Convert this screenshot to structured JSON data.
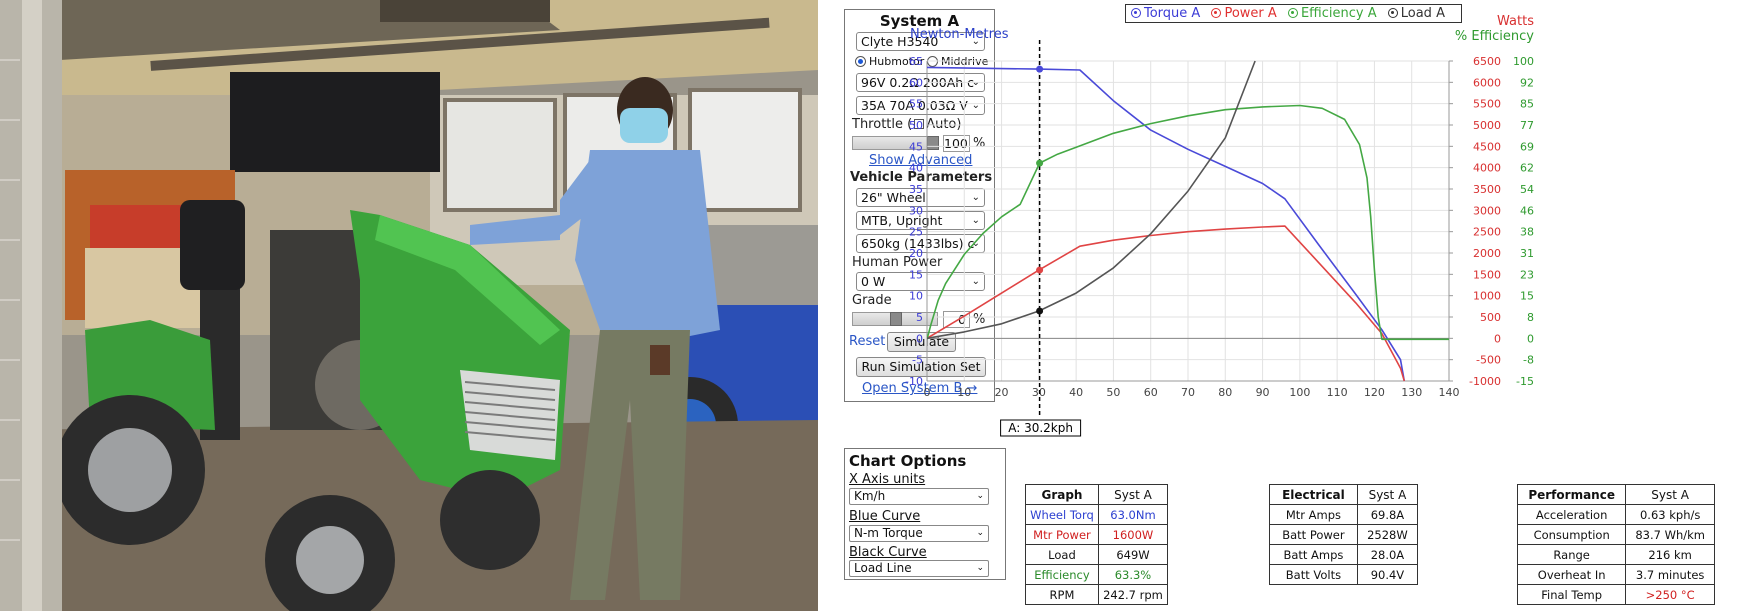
{
  "system_a": {
    "title": "System A",
    "motor": "Clyte H3540",
    "drive_options": [
      "Hubmotor",
      "Middrive"
    ],
    "drive_selected": "Hubmotor",
    "battery": "96V 0.2Ω 200Ah c",
    "controller": "35A 70A 0.03Ω V",
    "throttle_label": "Throttle (",
    "auto_label": "Auto)",
    "throttle_value": "100",
    "throttle_fraction": 1.0,
    "percent_sign": "%",
    "show_advanced": "Show Advanced",
    "vehicle_params_title": "Vehicle Parameters",
    "wheel": "26\"  Wheel",
    "frame": "MTB, Upright",
    "mass": "650kg (1433lbs) c",
    "human_power_label": "Human Power",
    "human_power": "0 W",
    "grade_label": "Grade",
    "grade_value": "0",
    "grade_fraction": 0.0,
    "reset_label": "Reset",
    "simulate_label": "Simulate",
    "run_set_label": "Run Simulation Set",
    "open_b_label": "Open System B →"
  },
  "legend": {
    "items": [
      {
        "label": "Torque A",
        "color": "#3b3bd6"
      },
      {
        "label": "Power A",
        "color": "#e03030"
      },
      {
        "label": "Efficiency A",
        "color": "#3aa63a"
      },
      {
        "label": "Load A",
        "color": "#333333"
      }
    ]
  },
  "chart_data": {
    "type": "line",
    "left_axis_title": "Newton-Metres",
    "right_axis_title_power": "Watts",
    "right_axis_title_eff": "% Efficiency",
    "x_ticks": [
      "0",
      "10",
      "20",
      "30",
      "40",
      "50",
      "60",
      "70",
      "80",
      "90",
      "100",
      "110",
      "120",
      "130",
      "140"
    ],
    "y_left_ticks": [
      "65",
      "60",
      "55",
      "50",
      "45",
      "40",
      "35",
      "30",
      "25",
      "20",
      "15",
      "10",
      "5",
      "0",
      "-5",
      "-10"
    ],
    "y_power_ticks": [
      "6500",
      "6000",
      "5500",
      "5000",
      "4500",
      "4000",
      "3500",
      "3000",
      "2500",
      "2000",
      "1500",
      "1000",
      "500",
      "0",
      "-500",
      "-1000"
    ],
    "y_eff_ticks": [
      "100",
      "92",
      "85",
      "77",
      "69",
      "62",
      "54",
      "46",
      "38",
      "31",
      "23",
      "15",
      "8",
      "0",
      "-8",
      "-15"
    ],
    "xlim": [
      0,
      140
    ],
    "ylim_left": [
      -10,
      65
    ],
    "cursor_x": 30.2,
    "cursor_label": "A: 30.2kph",
    "series": [
      {
        "name": "Torque A",
        "color": "#4a4ad8",
        "unit": "Nm",
        "x": [
          0,
          30,
          41,
          50,
          60,
          70,
          80,
          90,
          96,
          105,
          115,
          122,
          127,
          128
        ],
        "y": [
          63.5,
          63.1,
          62.9,
          55.7,
          48.8,
          44.3,
          40.3,
          36.3,
          32.7,
          22.0,
          10.3,
          2.0,
          -5.0,
          -10.0
        ]
      },
      {
        "name": "Power A",
        "color": "#e04444",
        "unit": "W",
        "x": [
          0,
          10,
          20,
          30,
          41,
          50,
          60,
          70,
          80,
          90,
          96,
          105,
          115,
          122,
          127,
          128
        ],
        "y": [
          0,
          520,
          1060,
          1600,
          2160,
          2300,
          2410,
          2500,
          2560,
          2610,
          2630,
          1780,
          830,
          110,
          -700,
          -1000
        ]
      },
      {
        "name": "Efficiency A",
        "color": "#44a844",
        "unit": "%",
        "x": [
          0,
          1,
          3,
          5,
          10,
          15,
          20,
          25,
          30.2,
          35,
          41,
          50,
          60,
          70,
          80,
          90,
          100,
          106,
          112,
          116,
          118,
          119,
          120,
          121,
          122,
          140
        ],
        "y": [
          0,
          5,
          14,
          20,
          30.5,
          38,
          44,
          48.5,
          63.3,
          66.5,
          69.5,
          74,
          77.5,
          80.3,
          82.5,
          83.5,
          84,
          83,
          79,
          70,
          58,
          44,
          25,
          8,
          0,
          0
        ]
      },
      {
        "name": "Load A",
        "color": "#555555",
        "unit": "Nm",
        "x": [
          0,
          10,
          20,
          30,
          40,
          50,
          60,
          70,
          80,
          88
        ],
        "y": [
          0,
          1.5,
          3.4,
          6.4,
          10.6,
          16.5,
          24.5,
          34.5,
          47.0,
          65.0
        ]
      }
    ],
    "markers": [
      {
        "series": "Torque A",
        "x": 30.2,
        "y": 63.1
      },
      {
        "series": "Efficiency A",
        "x": 30.2,
        "y": 63.3
      },
      {
        "series": "Power A",
        "x": 30.2,
        "y": 1600
      },
      {
        "series": "Load A",
        "x": 30.2,
        "y": 6.4
      }
    ],
    "grid": true
  },
  "chart_options": {
    "title": "Chart Options",
    "x_axis_label": "X Axis units",
    "x_axis_value": "Km/h",
    "blue_label": "Blue Curve",
    "blue_value": "N-m Torque",
    "black_label": "Black Curve",
    "black_value": "Load Line"
  },
  "graph_table": {
    "headers": [
      "Graph",
      "Syst A"
    ],
    "rows": [
      {
        "label": "Wheel Torq",
        "value": "63.0Nm",
        "color": "#2b3fd0"
      },
      {
        "label": "Mtr Power",
        "value": "1600W",
        "color": "#d02020"
      },
      {
        "label": "Load",
        "value": "649W",
        "color": "#111111"
      },
      {
        "label": "Efficiency",
        "value": "63.3%",
        "color": "#2a8a2a"
      },
      {
        "label": "RPM",
        "value": "242.7 rpm",
        "color": "#111111"
      }
    ]
  },
  "electrical_table": {
    "headers": [
      "Electrical",
      "Syst A"
    ],
    "rows": [
      {
        "label": "Mtr Amps",
        "value": "69.8A"
      },
      {
        "label": "Batt Power",
        "value": "2528W"
      },
      {
        "label": "Batt Amps",
        "value": "28.0A"
      },
      {
        "label": "Batt Volts",
        "value": "90.4V"
      }
    ]
  },
  "performance_table": {
    "headers": [
      "Performance",
      "Syst A"
    ],
    "rows": [
      {
        "label": "Acceleration",
        "value": "0.63 kph/s",
        "color": "#111111"
      },
      {
        "label": "Consumption",
        "value": "83.7 Wh/km",
        "color": "#111111"
      },
      {
        "label": "Range",
        "value": "216 km",
        "color": "#111111"
      },
      {
        "label": "Overheat In",
        "value": "3.7 minutes",
        "color": "#111111"
      },
      {
        "label": "Final Temp",
        "value": ">250 °C",
        "color": "#d02020"
      }
    ]
  }
}
